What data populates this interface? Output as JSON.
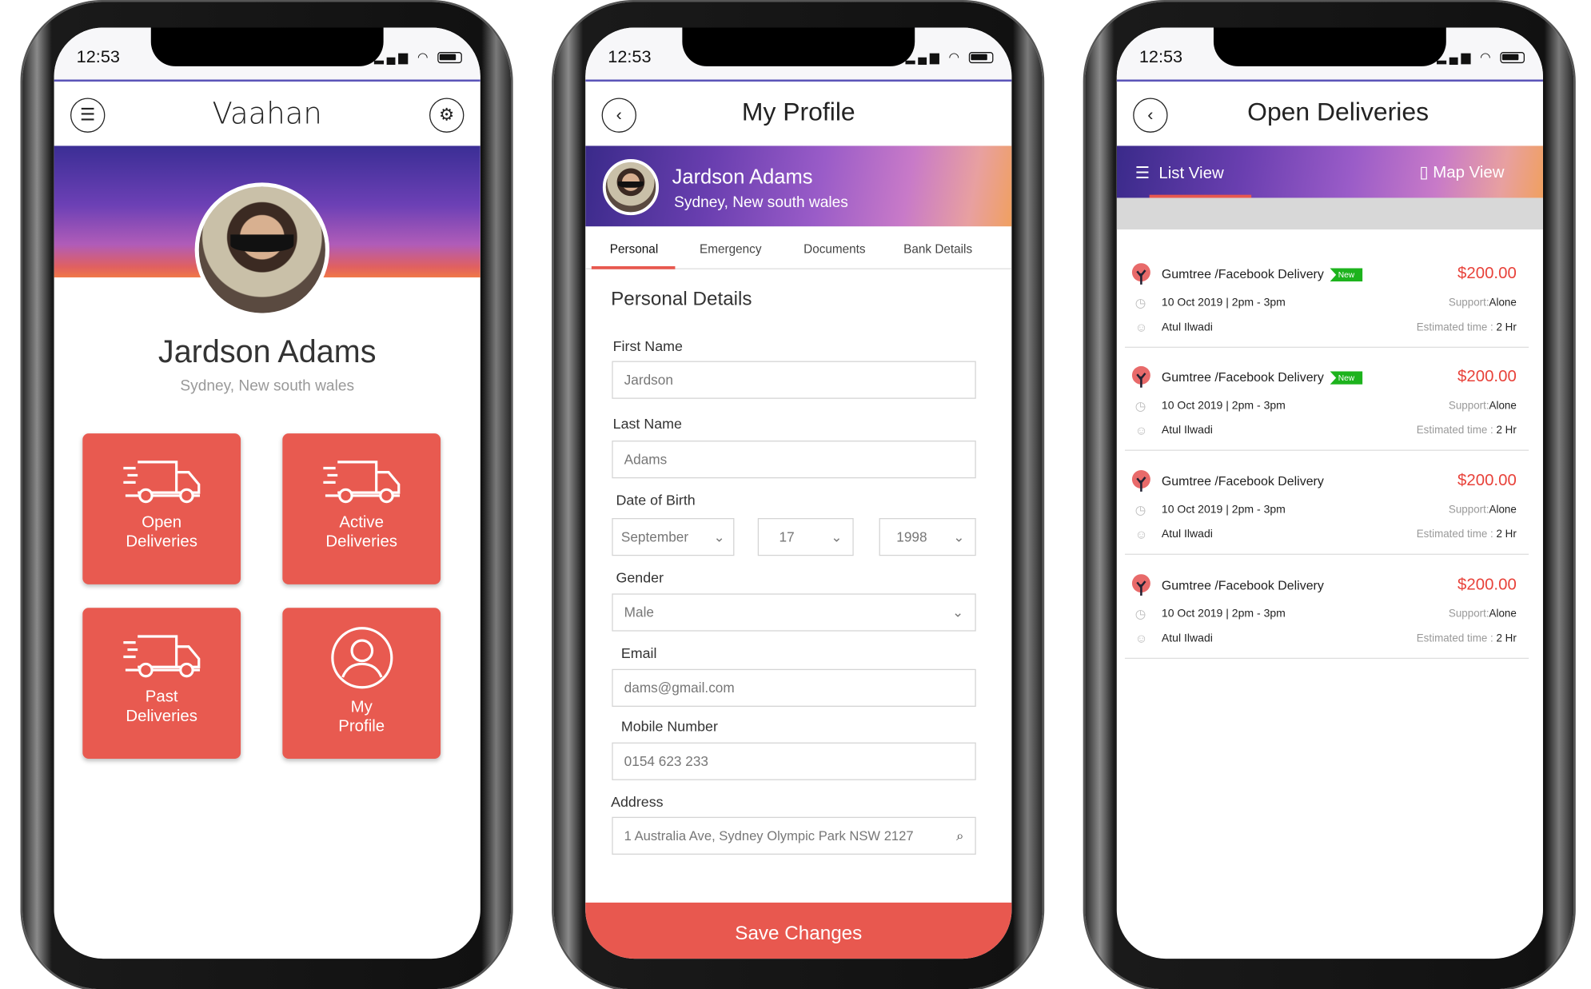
{
  "status": {
    "time": "12:53"
  },
  "home": {
    "title": "Vaahan",
    "menu_icon": "hamburger-icon",
    "settings_icon": "gear-icon",
    "name": "Jardson Adams",
    "location": "Sydney, New south wales",
    "tiles": [
      {
        "label1": "Open",
        "label2": "Deliveries",
        "icon": "truck-icon"
      },
      {
        "label1": "Active",
        "label2": "Deliveries",
        "icon": "truck-icon"
      },
      {
        "label1": "Past",
        "label2": "Deliveries",
        "icon": "truck-icon"
      },
      {
        "label1": "My",
        "label2": "Profile",
        "icon": "user-icon"
      }
    ],
    "tile_color": "#e85a50"
  },
  "profile": {
    "title": "My Profile",
    "name": "Jardson Adams",
    "location": "Sydney, New south wales",
    "tabs": [
      "Personal",
      "Emergency",
      "Documents",
      "Bank Details"
    ],
    "active_tab": "Personal",
    "section": "Personal Details",
    "first_name": {
      "label": "First Name",
      "value": "Jardson"
    },
    "last_name": {
      "label": "Last Name",
      "value": "Adams"
    },
    "dob": {
      "label": "Date of Birth",
      "month": "September",
      "day": "17",
      "year": "1998"
    },
    "gender": {
      "label": "Gender",
      "value": "Male"
    },
    "email": {
      "label": "Email",
      "value": "dams@gmail.com"
    },
    "mobile": {
      "label": "Mobile Number",
      "value": "0154 623 233"
    },
    "address": {
      "label": "Address",
      "value": "1 Australia Ave, Sydney Olympic Park NSW 2127"
    },
    "save": "Save Changes",
    "accent": "#e8584f"
  },
  "deliveries": {
    "title": "Open Deliveries",
    "list_view": "List View",
    "map_view": "Map View",
    "items": [
      {
        "title": "Gumtree /Facebook Delivery",
        "badge": "New",
        "price": "$200.00",
        "date": "10 Oct 2019 | 2pm - 3pm",
        "support_label": "Support:",
        "support": "Alone",
        "person": "Atul Ilwadi",
        "est_label": "Estimated time :",
        "est": "2 Hr"
      },
      {
        "title": "Gumtree /Facebook Delivery",
        "badge": "New",
        "price": "$200.00",
        "date": "10 Oct 2019 | 2pm - 3pm",
        "support_label": "Support:",
        "support": "Alone",
        "person": "Atul Ilwadi",
        "est_label": "Estimated time :",
        "est": "2 Hr"
      },
      {
        "title": "Gumtree /Facebook Delivery",
        "badge": "",
        "price": "$200.00",
        "date": "10 Oct 2019 | 2pm - 3pm",
        "support_label": "Support:",
        "support": "Alone",
        "person": "Atul Ilwadi",
        "est_label": "Estimated time :",
        "est": "2 Hr"
      },
      {
        "title": "Gumtree /Facebook Delivery",
        "badge": "",
        "price": "$200.00",
        "date": "10 Oct 2019 | 2pm - 3pm",
        "support_label": "Support:",
        "support": "Alone",
        "person": "Atul Ilwadi",
        "est_label": "Estimated time :",
        "est": "2 Hr"
      }
    ]
  }
}
